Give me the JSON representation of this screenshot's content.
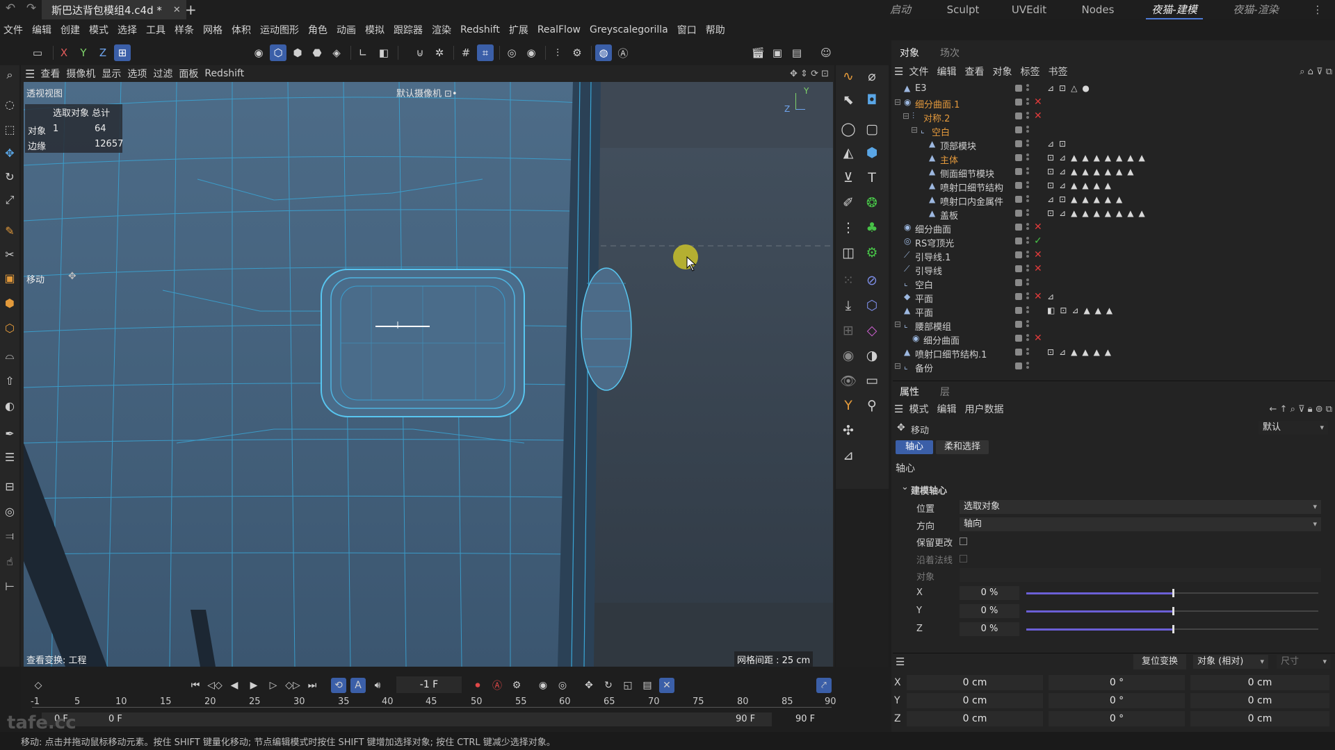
{
  "title_bar": {
    "undo": "↶",
    "redo": "↷",
    "doc_tab": "斯巴达背包模组4.c4d *",
    "close": "✕",
    "add": "+",
    "layouts": [
      "启动",
      "Sculpt",
      "UVEdit",
      "Nodes",
      "夜猫-建模",
      "夜猫-渲染"
    ],
    "active_layout": "夜猫-建模",
    "more": "⋮"
  },
  "menu": [
    "文件",
    "编辑",
    "创建",
    "模式",
    "选择",
    "工具",
    "样条",
    "网格",
    "体积",
    "运动图形",
    "角色",
    "动画",
    "模拟",
    "跟踪器",
    "渲染",
    "Redshift",
    "扩展",
    "RealFlow",
    "Greyscalegorilla",
    "窗口",
    "帮助"
  ],
  "toolbar": {
    "axis_x": "X",
    "axis_y": "Y",
    "axis_z": "Z"
  },
  "viewport": {
    "menu": [
      "查看",
      "摄像机",
      "显示",
      "选项",
      "过滤",
      "面板",
      "Redshift"
    ],
    "label": "透视视图",
    "camera": "默认摄像机 ⊡•",
    "stats": {
      "header": "选取对象 总计",
      "rows": [
        {
          "label": "对象",
          "selected": "1",
          "total": "64"
        },
        {
          "label": "边缘",
          "selected": "",
          "total": "12657"
        }
      ]
    },
    "tool_label": "移动",
    "view_transform": "查看变换: 工程",
    "grid_distance": "网格间距 : 25 cm",
    "axis_y": "Y",
    "axis_z": "Z"
  },
  "timeline": {
    "frame": "-1 F",
    "ticks": [
      "-1",
      "5",
      "10",
      "15",
      "20",
      "25",
      "30",
      "35",
      "40",
      "45",
      "50",
      "55",
      "60",
      "65",
      "70",
      "75",
      "80",
      "85",
      "90"
    ],
    "start_a": "0 F",
    "start_b": "0 F",
    "end_a": "90 F",
    "end_b": "90 F"
  },
  "status": "移动: 点击并拖动鼠标移动元素。按住 SHIFT 键量化移动; 节点编辑模式时按住 SHIFT 键增加选择对象; 按住 CTRL 键减少选择对象。",
  "watermark": "tafe.cc",
  "object_manager": {
    "tabs": [
      "对象",
      "场次"
    ],
    "menu": [
      "文件",
      "编辑",
      "查看",
      "对象",
      "标签",
      "书签"
    ],
    "rows": [
      {
        "name": "E3",
        "indent": 0,
        "icon": "▲",
        "orange": false,
        "flag": "",
        "tags": "⊿⊡△●"
      },
      {
        "name": "细分曲面.1",
        "indent": 0,
        "icon": "◉",
        "orange": true,
        "flag": "x",
        "tags": ""
      },
      {
        "name": "对称.2",
        "indent": 1,
        "icon": "⫶",
        "orange": true,
        "flag": "x",
        "tags": ""
      },
      {
        "name": "空白",
        "indent": 2,
        "icon": "⌞",
        "orange": true,
        "flag": "",
        "tags": ""
      },
      {
        "name": "顶部模块",
        "indent": 3,
        "icon": "▲",
        "orange": false,
        "flag": "",
        "tags": "⊿⊡"
      },
      {
        "name": "主体",
        "indent": 3,
        "icon": "▲",
        "orange": true,
        "flag": "",
        "tags": "⊡⊿▲▲▲▲▲▲▲"
      },
      {
        "name": "侧面细节模块",
        "indent": 3,
        "icon": "▲",
        "orange": false,
        "flag": "",
        "tags": "⊡⊿▲▲▲▲▲▲"
      },
      {
        "name": "喷射口细节结构",
        "indent": 3,
        "icon": "▲",
        "orange": false,
        "flag": "",
        "tags": "⊡⊿▲▲▲▲"
      },
      {
        "name": "喷射口内金属件",
        "indent": 3,
        "icon": "▲",
        "orange": false,
        "flag": "",
        "tags": "⊿⊡▲▲▲▲▲"
      },
      {
        "name": "盖板",
        "indent": 3,
        "icon": "▲",
        "orange": false,
        "flag": "",
        "tags": "⊡⊿▲▲▲▲▲▲▲"
      },
      {
        "name": "细分曲面",
        "indent": 0,
        "icon": "◉",
        "orange": false,
        "flag": "x",
        "tags": ""
      },
      {
        "name": "RS穹顶光",
        "indent": 0,
        "icon": "◎",
        "orange": false,
        "flag": "ok",
        "tags": ""
      },
      {
        "name": "引导线.1",
        "indent": 0,
        "icon": "⟋",
        "orange": false,
        "flag": "x",
        "tags": ""
      },
      {
        "name": "引导线",
        "indent": 0,
        "icon": "⟋",
        "orange": false,
        "flag": "x",
        "tags": ""
      },
      {
        "name": "空白",
        "indent": 0,
        "icon": "⌞",
        "orange": false,
        "flag": "",
        "tags": ""
      },
      {
        "name": "平面",
        "indent": 0,
        "icon": "◆",
        "orange": false,
        "flag": "x",
        "tags": "⊿"
      },
      {
        "name": "平面",
        "indent": 0,
        "icon": "▲",
        "orange": false,
        "flag": "",
        "tags": "◧⊡⊿▲▲▲"
      },
      {
        "name": "腰部模组",
        "indent": 0,
        "icon": "⌞",
        "orange": false,
        "flag": "",
        "tags": ""
      },
      {
        "name": "细分曲面",
        "indent": 1,
        "icon": "◉",
        "orange": false,
        "flag": "x",
        "tags": ""
      },
      {
        "name": "喷射口细节结构.1",
        "indent": 0,
        "icon": "▲",
        "orange": false,
        "flag": "",
        "tags": "⊡⊿▲▲▲▲"
      },
      {
        "name": "备份",
        "indent": 0,
        "icon": "⌞",
        "orange": false,
        "flag": "",
        "tags": ""
      }
    ]
  },
  "attributes": {
    "tabs": [
      "属性",
      "层"
    ],
    "menu": [
      "模式",
      "编辑",
      "用户数据"
    ],
    "tool": "移动",
    "preset": "默认",
    "subtabs": [
      "轴心",
      "柔和选择"
    ],
    "section": "轴心",
    "group": "建模轴心",
    "position_label": "位置",
    "position_value": "选取对象",
    "direction_label": "方向",
    "direction_value": "轴向",
    "keep_changes": "保留更改",
    "along_normal": "沿着法线",
    "object_label": "对象",
    "axes": [
      {
        "label": "X",
        "value": "0 %",
        "fill": 0.5
      },
      {
        "label": "Y",
        "value": "0 %",
        "fill": 0.5
      },
      {
        "label": "Z",
        "value": "0 %",
        "fill": 0.5
      }
    ]
  },
  "coords": {
    "reset": "复位变换",
    "mode": "对象 (相对)",
    "size": "尺寸",
    "rows": [
      {
        "label": "X",
        "pos": "0 cm",
        "rot": "0 °",
        "size": "0 cm"
      },
      {
        "label": "Y",
        "pos": "0 cm",
        "rot": "0 °",
        "size": "0 cm"
      },
      {
        "label": "Z",
        "pos": "0 cm",
        "rot": "0 °",
        "size": "0 cm"
      }
    ]
  }
}
